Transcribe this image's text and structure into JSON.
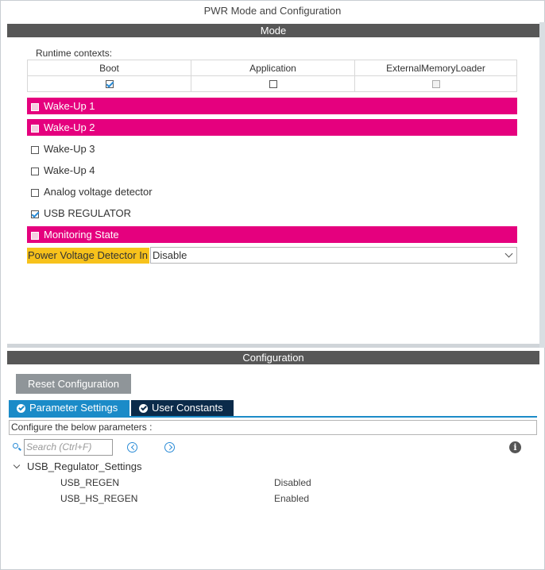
{
  "window": {
    "title": "PWR Mode and Configuration"
  },
  "mode": {
    "header": "Mode",
    "runtime_label": "Runtime contexts:",
    "contexts": [
      {
        "name": "Boot",
        "checked": true,
        "enabled": true
      },
      {
        "name": "Application",
        "checked": false,
        "enabled": true
      },
      {
        "name": "ExternalMemoryLoader",
        "checked": false,
        "enabled": false
      }
    ],
    "options": [
      {
        "label": "Wake-Up 1",
        "checked": false,
        "highlighted": true
      },
      {
        "label": "Wake-Up 2",
        "checked": false,
        "highlighted": true
      },
      {
        "label": "Wake-Up 3",
        "checked": false,
        "highlighted": false
      },
      {
        "label": "Wake-Up 4",
        "checked": false,
        "highlighted": false
      },
      {
        "label": "Analog voltage detector",
        "checked": false,
        "highlighted": false
      },
      {
        "label": "USB REGULATOR",
        "checked": true,
        "highlighted": false
      },
      {
        "label": "Monitoring State",
        "checked": false,
        "highlighted": true
      }
    ],
    "pvd": {
      "label": "Power Voltage Detector In",
      "value": "Disable"
    }
  },
  "configuration": {
    "header": "Configuration",
    "reset_label": "Reset Configuration",
    "tabs": [
      {
        "label": "Parameter Settings",
        "active": true
      },
      {
        "label": "User Constants",
        "active": false
      }
    ],
    "description": "Configure the below parameters :",
    "search_placeholder": "Search (Ctrl+F)",
    "info_glyph": "i",
    "group": {
      "label": "USB_Regulator_Settings",
      "params": [
        {
          "name": "USB_REGEN",
          "value": "Disabled"
        },
        {
          "name": "USB_HS_REGEN",
          "value": "Enabled"
        }
      ]
    }
  },
  "colors": {
    "highlight": "#e5007e",
    "pvd_highlight": "#f7c21b",
    "tab_active": "#1b8bc8",
    "tab_inactive": "#0b2b4a",
    "section_bar": "#575757"
  }
}
